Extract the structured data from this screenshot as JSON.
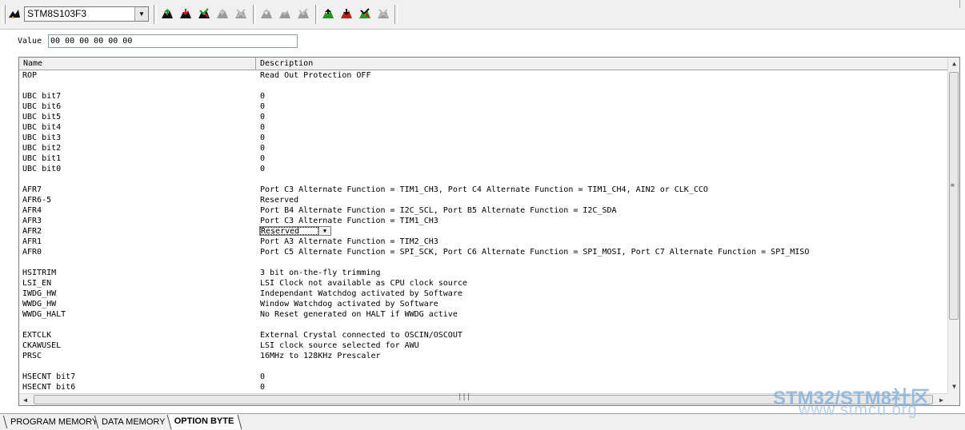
{
  "toolbar": {
    "device_name": "STM8S103F3",
    "colors": {
      "green": "#1a9a1a",
      "red": "#c81818",
      "gray": "#9a9a9a",
      "black": "#111111"
    },
    "icons": [
      "chip-select-icon",
      "read-icon",
      "program-icon",
      "verify-icon",
      "compare-disabled-icon",
      "erase-disabled-icon",
      "read-all-disabled-icon",
      "program-all-disabled-icon",
      "verify-all-disabled-icon",
      "read-option-icon",
      "program-option-icon",
      "verify-option-icon",
      "erase-option-disabled-icon"
    ]
  },
  "value_row": {
    "label": "Value",
    "value": "00 00 00 00 00 00"
  },
  "grid": {
    "columns": {
      "name": "Name",
      "description": "Description"
    },
    "rows": [
      {
        "name": "ROP",
        "description": "Read Out Protection OFF"
      },
      {
        "name": "",
        "description": ""
      },
      {
        "name": "UBC bit7",
        "description": "0"
      },
      {
        "name": "UBC bit6",
        "description": "0"
      },
      {
        "name": "UBC bit5",
        "description": "0"
      },
      {
        "name": "UBC bit4",
        "description": "0"
      },
      {
        "name": "UBC bit3",
        "description": "0"
      },
      {
        "name": "UBC bit2",
        "description": "0"
      },
      {
        "name": "UBC bit1",
        "description": "0"
      },
      {
        "name": "UBC bit0",
        "description": "0"
      },
      {
        "name": "",
        "description": ""
      },
      {
        "name": "AFR7",
        "description": "Port C3 Alternate Function = TIM1_CH3, Port C4 Alternate Function = TIM1_CH4, AIN2 or CLK_CCO"
      },
      {
        "name": "AFR6-5",
        "description": "Reserved"
      },
      {
        "name": "AFR4",
        "description": "Port B4 Alternate Function = I2C_SCL, Port B5 Alternate Function = I2C_SDA"
      },
      {
        "name": "AFR3",
        "description": "Port C3 Alternate Function = TIM1_CH3"
      },
      {
        "name": "AFR2",
        "description": "Reserved"
      },
      {
        "name": "AFR1",
        "description": "Port A3 Alternate Function = TIM2_CH3"
      },
      {
        "name": "AFR0",
        "description": "Port C5 Alternate Function = SPI_SCK, Port C6 Alternate Function = SPI_MOSI, Port C7 Alternate Function = SPI_MISO"
      },
      {
        "name": "",
        "description": ""
      },
      {
        "name": "HSITRIM",
        "description": "3 bit on-the-fly trimming"
      },
      {
        "name": "LSI_EN",
        "description": "LSI Clock not available as CPU clock source"
      },
      {
        "name": "IWDG_HW",
        "description": "Independant Watchdog activated by Software"
      },
      {
        "name": "WWDG_HW",
        "description": "Window Watchdog activated by Software"
      },
      {
        "name": "WWDG_HALT",
        "description": "No Reset generated on HALT if WWDG active"
      },
      {
        "name": "",
        "description": ""
      },
      {
        "name": "EXTCLK",
        "description": "External Crystal connected to OSCIN/OSCOUT"
      },
      {
        "name": "CKAWUSEL",
        "description": "LSI clock source selected for AWU"
      },
      {
        "name": "PRSC",
        "description": "16MHz to 128KHz Prescaler"
      },
      {
        "name": "",
        "description": ""
      },
      {
        "name": "HSECNT bit7",
        "description": "0"
      },
      {
        "name": "HSECNT bit6",
        "description": "0"
      }
    ],
    "selected_row_index": 15
  },
  "tabs": [
    {
      "label": "PROGRAM MEMORY",
      "active": false
    },
    {
      "label": "DATA MEMORY",
      "active": false
    },
    {
      "label": "OPTION BYTE",
      "active": true
    }
  ],
  "watermark": {
    "brand": "STM32/STM8社区",
    "url": "www.stmcu.org"
  }
}
